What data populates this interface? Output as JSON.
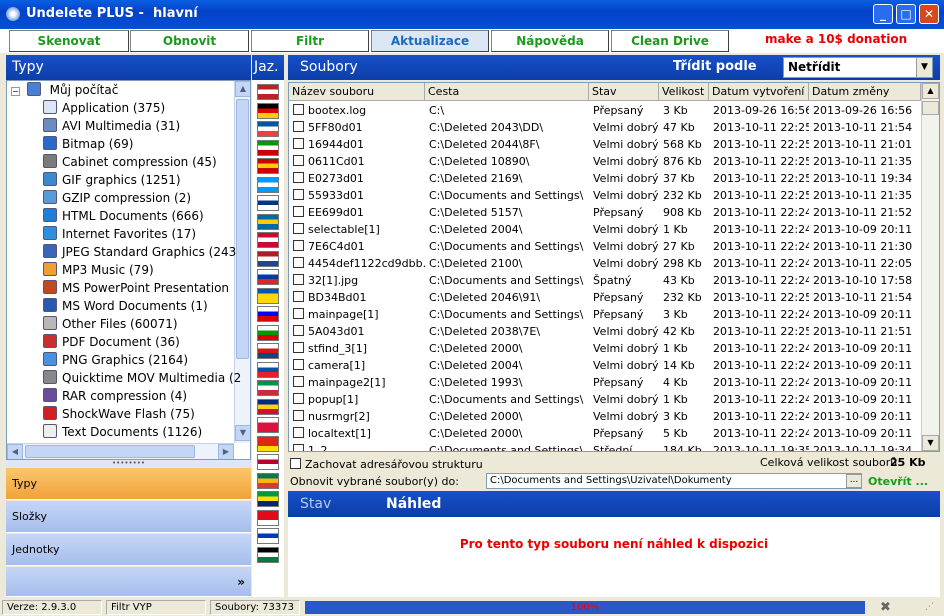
{
  "window": {
    "title": "Undelete PLUS -  hlavní"
  },
  "toolbar": {
    "buttons": [
      "Skenovat",
      "Obnovit",
      "Filtr",
      "Aktualizace",
      "Nápověda",
      "Clean Drive"
    ],
    "donate": "make a 10$ donation"
  },
  "left": {
    "title": "Typy",
    "root": "Můj počítač",
    "items": [
      {
        "label": "Application (375)",
        "icon": "application-icon"
      },
      {
        "label": "AVI Multimedia (31)",
        "icon": "avi-icon"
      },
      {
        "label": "Bitmap (69)",
        "icon": "bitmap-icon"
      },
      {
        "label": "Cabinet compression (45)",
        "icon": "cabinet-icon"
      },
      {
        "label": "GIF graphics (1251)",
        "icon": "gif-icon"
      },
      {
        "label": "GZIP compression (2)",
        "icon": "gzip-icon"
      },
      {
        "label": "HTML Documents (666)",
        "icon": "html-icon"
      },
      {
        "label": "Internet Favorites (17)",
        "icon": "favorites-icon"
      },
      {
        "label": "JPEG Standard Graphics (243",
        "icon": "jpeg-icon"
      },
      {
        "label": "MP3 Music (79)",
        "icon": "mp3-icon"
      },
      {
        "label": "MS PowerPoint Presentation",
        "icon": "powerpoint-icon"
      },
      {
        "label": "MS Word Documents (1)",
        "icon": "word-icon"
      },
      {
        "label": "Other Files (60071)",
        "icon": "other-files-icon"
      },
      {
        "label": "PDF Document (36)",
        "icon": "pdf-icon"
      },
      {
        "label": "PNG Graphics (2164)",
        "icon": "png-icon"
      },
      {
        "label": "Quicktime MOV Multimedia (2",
        "icon": "quicktime-icon"
      },
      {
        "label": "RAR compression (4)",
        "icon": "rar-icon"
      },
      {
        "label": "ShockWave Flash (75)",
        "icon": "flash-icon"
      },
      {
        "label": "Text Documents (1126)",
        "icon": "text-icon"
      }
    ],
    "nav": [
      "Typy",
      "Složky",
      "Jednotky"
    ]
  },
  "flags": {
    "title": "Jaz."
  },
  "files": {
    "title": "Soubory",
    "sort_label": "Třídit podle",
    "sort_value": "Netřídit",
    "columns": [
      "Název souboru",
      "Cesta",
      "Stav",
      "Velikost",
      "Datum vytvoření",
      "Datum změny"
    ],
    "rows": [
      [
        "bootex.log",
        "C:\\",
        "Přepsaný",
        "3 Kb",
        "2013-09-26 16:56",
        "2013-09-26 16:56"
      ],
      [
        "5FF80d01",
        "C:\\Deleted 2043\\DD\\",
        "Velmi dobrý",
        "47 Kb",
        "2013-10-11 22:25",
        "2013-10-11 21:54"
      ],
      [
        "16944d01",
        "C:\\Deleted 2044\\8F\\",
        "Velmi dobrý",
        "568 Kb",
        "2013-10-11 22:25",
        "2013-10-11 21:01"
      ],
      [
        "0611Cd01",
        "C:\\Deleted 10890\\",
        "Velmi dobrý",
        "876 Kb",
        "2013-10-11 22:25",
        "2013-10-11 21:35"
      ],
      [
        "E0273d01",
        "C:\\Deleted 2169\\",
        "Velmi dobrý",
        "37 Kb",
        "2013-10-11 22:25",
        "2013-10-11 19:34"
      ],
      [
        "55933d01",
        "C:\\Documents and Settings\\",
        "Velmi dobrý",
        "232 Kb",
        "2013-10-11 22:25",
        "2013-10-11 21:35"
      ],
      [
        "EE699d01",
        "C:\\Deleted 5157\\",
        "Přepsaný",
        "908 Kb",
        "2013-10-11 22:24",
        "2013-10-11 21:52"
      ],
      [
        "selectable[1]",
        "C:\\Deleted 2004\\",
        "Velmi dobrý",
        "1 Kb",
        "2013-10-11 22:24",
        "2013-10-09 20:11"
      ],
      [
        "7E6C4d01",
        "C:\\Documents and Settings\\",
        "Velmi dobrý",
        "27 Kb",
        "2013-10-11 22:24",
        "2013-10-11 21:30"
      ],
      [
        "4454def1122cd9dbb...",
        "C:\\Deleted 2100\\",
        "Velmi dobrý",
        "298 Kb",
        "2013-10-11 22:24",
        "2013-10-11 22:05"
      ],
      [
        "32[1].jpg",
        "C:\\Documents and Settings\\",
        "Špatný",
        "43 Kb",
        "2013-10-11 22:24",
        "2013-10-10 17:58"
      ],
      [
        "BD34Bd01",
        "C:\\Deleted 2046\\91\\",
        "Přepsaný",
        "232 Kb",
        "2013-10-11 22:25",
        "2013-10-11 21:54"
      ],
      [
        "mainpage[1]",
        "C:\\Documents and Settings\\",
        "Přepsaný",
        "3 Kb",
        "2013-10-11 22:24",
        "2013-10-09 20:11"
      ],
      [
        "5A043d01",
        "C:\\Deleted 2038\\7E\\",
        "Velmi dobrý",
        "42 Kb",
        "2013-10-11 22:25",
        "2013-10-11 21:51"
      ],
      [
        "stfind_3[1]",
        "C:\\Deleted 2000\\",
        "Velmi dobrý",
        "1 Kb",
        "2013-10-11 22:24",
        "2013-10-09 20:11"
      ],
      [
        "camera[1]",
        "C:\\Deleted 2004\\",
        "Velmi dobrý",
        "14 Kb",
        "2013-10-11 22:24",
        "2013-10-09 20:11"
      ],
      [
        "mainpage2[1]",
        "C:\\Deleted 1993\\",
        "Přepsaný",
        "4 Kb",
        "2013-10-11 22:24",
        "2013-10-09 20:11"
      ],
      [
        "popup[1]",
        "C:\\Documents and Settings\\",
        "Velmi dobrý",
        "1 Kb",
        "2013-10-11 22:24",
        "2013-10-09 20:11"
      ],
      [
        "nusrmgr[2]",
        "C:\\Deleted 2000\\",
        "Velmi dobrý",
        "3 Kb",
        "2013-10-11 22:24",
        "2013-10-09 20:11"
      ],
      [
        "localtext[1]",
        "C:\\Deleted 2000\\",
        "Přepsaný",
        "5 Kb",
        "2013-10-11 22:24",
        "2013-10-09 20:11"
      ],
      [
        "1_2",
        "C:\\Documents and Settings\\",
        "Střední",
        "184 Kb",
        "2013-10-11 19:35",
        "2013-10-11 19:34"
      ]
    ],
    "keep_structure": "Zachovat adresářovou strukturu",
    "total_label": "Celková velikost souborů:",
    "total_value": "25 Kb",
    "restore_label": "Obnovit vybrané soubor(y) do:",
    "restore_path": "C:\\Documents and Settings\\Uzivatel\\Dokumenty",
    "browse": "...",
    "open": "Otevřít ..."
  },
  "preview": {
    "tab1": "Stav",
    "tab2": "Náhled",
    "message": "Pro tento typ souboru není náhled k dispozici"
  },
  "status": {
    "version": "Verze: 2.9.3.0",
    "filter": "Filtr VYP",
    "count": "Soubory: 73373",
    "progress": 1.0,
    "progress_label": "100%"
  }
}
